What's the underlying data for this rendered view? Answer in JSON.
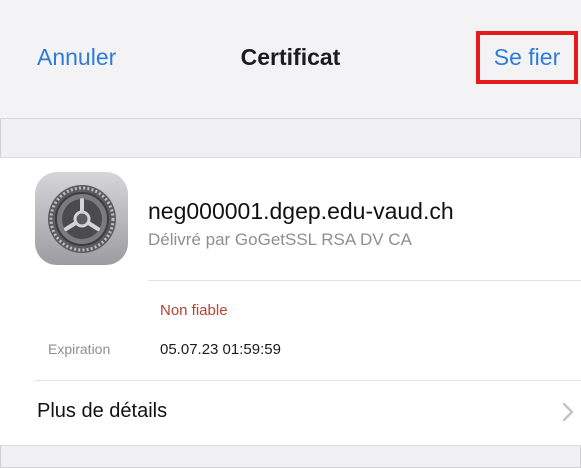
{
  "navbar": {
    "cancel_label": "Annuler",
    "title": "Certificat",
    "trust_label": "Se fier"
  },
  "certificate": {
    "icon": "settings-gear-icon",
    "domain": "neg000001.dgep.edu-vaud.ch",
    "issuer": "Délivré par GoGetSSL RSA DV CA",
    "status": "Non fiable",
    "expiration_label": "Expiration",
    "expiration_value": "05.07.23 01:59:59"
  },
  "more_details": {
    "label": "Plus de détails",
    "icon": "chevron-right-icon"
  },
  "colors": {
    "accent": "#2f7bd6",
    "highlight_box": "#e51a1a",
    "status_untrusted": "#b5432e"
  }
}
